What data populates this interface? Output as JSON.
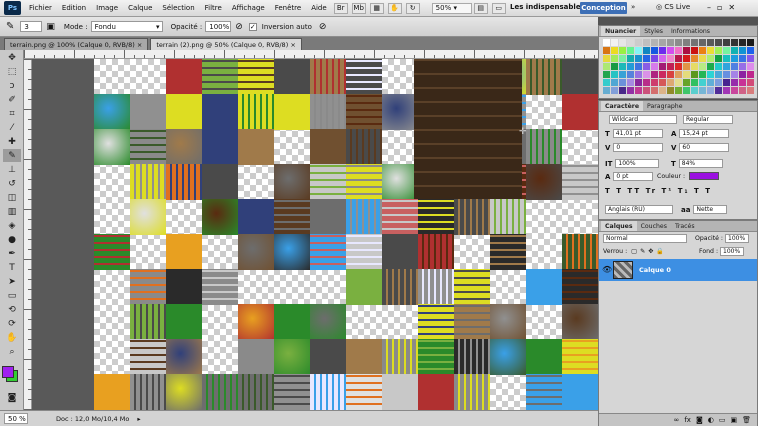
{
  "app": {
    "logo": "Ps"
  },
  "menu": [
    "Fichier",
    "Edition",
    "Image",
    "Calque",
    "Sélection",
    "Filtre",
    "Affichage",
    "Fenêtre",
    "Aide"
  ],
  "menu_zoom": "50%",
  "workspaces": {
    "essentials": "Les indispensables",
    "design": "Conception",
    "more": "»",
    "cs_live": "CS Live"
  },
  "options": {
    "mode_label": "Mode :",
    "mode_value": "Fondu",
    "opacity_label": "Opacité :",
    "opacity_value": "100%",
    "airbrush_label": "Inversion auto",
    "size": "3"
  },
  "tabs": [
    "terrain.png @ 100% (Calque 0, RVB/8)",
    "terrain (2).png @ 50% (Calque 0, RVB/8)"
  ],
  "status": {
    "zoom": "50 %",
    "doc": "Doc : 12,0 Mo/10,4 Mo"
  },
  "swatches_panel": {
    "tabs": [
      "Nuancier",
      "Styles",
      "Informations"
    ]
  },
  "character_panel": {
    "tabs": [
      "Caractère",
      "Paragraphe"
    ],
    "font_family": "Wildcard",
    "font_style": "Regular",
    "size": "41,01 pt",
    "leading": "15,24 pt",
    "tracking": "60",
    "vscale": "100%",
    "hscale": "84%",
    "baseline": "0 pt",
    "color_label": "Couleur :",
    "language": "Anglais (RU)",
    "aa": "Nette",
    "kern": "0"
  },
  "layers_panel": {
    "tabs": [
      "Calques",
      "Couches",
      "Tracés"
    ],
    "blend": "Normal",
    "opacity_label": "Opacité :",
    "opacity": "100%",
    "lock_label": "Verrou :",
    "fill_label": "Fond :",
    "fill": "100%",
    "layer_name": "Calque 0"
  },
  "colors": {
    "foreground": "#a020f0",
    "background": "#33cc33",
    "accent": "#3d6fb6",
    "text_color": "#9b10e0"
  }
}
